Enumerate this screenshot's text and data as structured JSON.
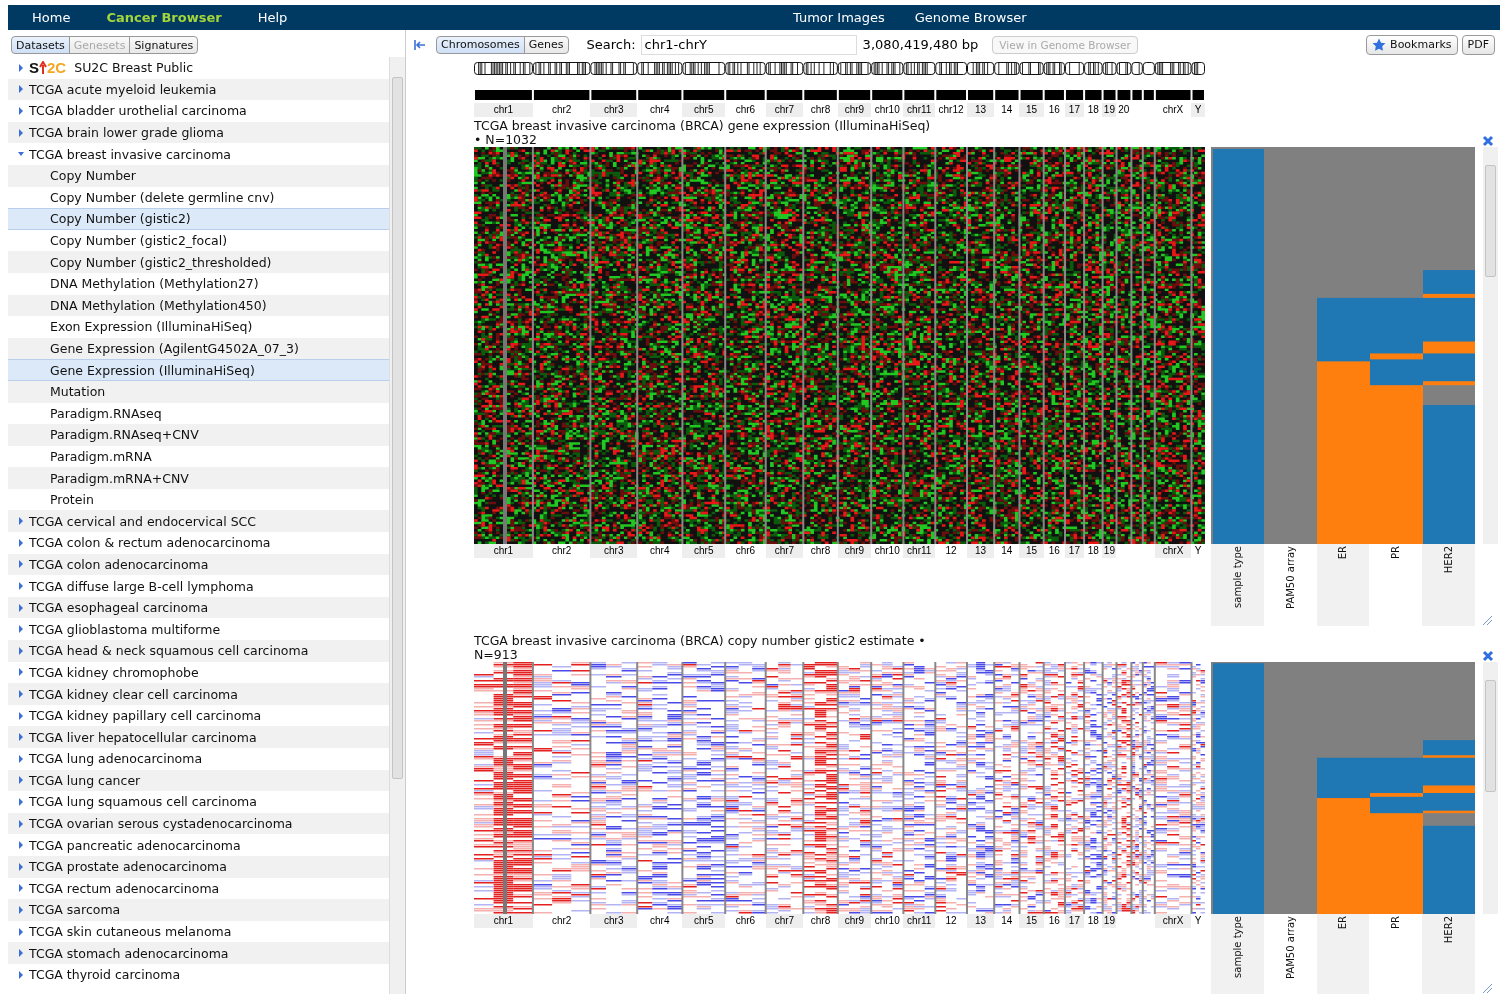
{
  "nav": {
    "left": [
      {
        "label": "Home",
        "selected": false
      },
      {
        "label": "Cancer Browser",
        "selected": true
      },
      {
        "label": "Help",
        "selected": false
      }
    ],
    "right": [
      {
        "label": "Tumor Images"
      },
      {
        "label": "Genome Browser"
      }
    ]
  },
  "sidebar": {
    "tabs": [
      {
        "label": "Datasets",
        "selected": true,
        "disabled": false
      },
      {
        "label": "Genesets",
        "selected": false,
        "disabled": true
      },
      {
        "label": "Signatures",
        "selected": false,
        "disabled": false
      }
    ],
    "items": [
      {
        "logo": [
          "S",
          "2C"
        ],
        "label": "SU2C Breast Public",
        "expanded": false
      },
      {
        "label": "TCGA acute myeloid leukemia",
        "expanded": false
      },
      {
        "label": "TCGA bladder urothelial carcinoma",
        "expanded": false
      },
      {
        "label": "TCGA brain lower grade glioma",
        "expanded": false
      },
      {
        "label": "TCGA breast invasive carcinoma",
        "expanded": true,
        "children": [
          {
            "label": "Copy Number",
            "selected": false
          },
          {
            "label": "Copy Number (delete germline cnv)",
            "selected": false
          },
          {
            "label": "Copy Number (gistic2)",
            "selected": true
          },
          {
            "label": "Copy Number (gistic2_focal)",
            "selected": false
          },
          {
            "label": "Copy Number (gistic2_thresholded)",
            "selected": false
          },
          {
            "label": "DNA Methylation (Methylation27)",
            "selected": false
          },
          {
            "label": "DNA Methylation (Methylation450)",
            "selected": false
          },
          {
            "label": "Exon Expression (IlluminaHiSeq)",
            "selected": false
          },
          {
            "label": "Gene Expression (AgilentG4502A_07_3)",
            "selected": false
          },
          {
            "label": "Gene Expression (IlluminaHiSeq)",
            "selected": true
          },
          {
            "label": "Mutation",
            "selected": false
          },
          {
            "label": "Paradigm.RNAseq",
            "selected": false
          },
          {
            "label": "Paradigm.RNAseq+CNV",
            "selected": false
          },
          {
            "label": "Paradigm.mRNA",
            "selected": false
          },
          {
            "label": "Paradigm.mRNA+CNV",
            "selected": false
          },
          {
            "label": "Protein",
            "selected": false
          }
        ]
      },
      {
        "label": "TCGA cervical and endocervical SCC",
        "expanded": false
      },
      {
        "label": "TCGA colon & rectum adenocarcinoma",
        "expanded": false
      },
      {
        "label": "TCGA colon adenocarcinoma",
        "expanded": false
      },
      {
        "label": "TCGA diffuse large B-cell lymphoma",
        "expanded": false
      },
      {
        "label": "TCGA esophageal carcinoma",
        "expanded": false
      },
      {
        "label": "TCGA glioblastoma multiforme",
        "expanded": false
      },
      {
        "label": "TCGA head & neck squamous cell carcinoma",
        "expanded": false
      },
      {
        "label": "TCGA kidney chromophobe",
        "expanded": false
      },
      {
        "label": "TCGA kidney clear cell carcinoma",
        "expanded": false
      },
      {
        "label": "TCGA kidney papillary cell carcinoma",
        "expanded": false
      },
      {
        "label": "TCGA liver hepatocellular carcinoma",
        "expanded": false
      },
      {
        "label": "TCGA lung adenocarcinoma",
        "expanded": false
      },
      {
        "label": "TCGA lung cancer",
        "expanded": false
      },
      {
        "label": "TCGA lung squamous cell carcinoma",
        "expanded": false
      },
      {
        "label": "TCGA ovarian serous cystadenocarcinoma",
        "expanded": false
      },
      {
        "label": "TCGA pancreatic adenocarcinoma",
        "expanded": false
      },
      {
        "label": "TCGA prostate adenocarcinoma",
        "expanded": false
      },
      {
        "label": "TCGA rectum adenocarcinoma",
        "expanded": false
      },
      {
        "label": "TCGA sarcoma",
        "expanded": false
      },
      {
        "label": "TCGA skin cutaneous melanoma",
        "expanded": false
      },
      {
        "label": "TCGA stomach adenocarcinoma",
        "expanded": false
      },
      {
        "label": "TCGA thyroid carcinoma",
        "expanded": false
      }
    ]
  },
  "toolbar": {
    "view_tabs": [
      {
        "label": "Chromosomes",
        "selected": true
      },
      {
        "label": "Genes",
        "selected": false
      }
    ],
    "search_label": "Search:",
    "search_value": "chr1-chrY",
    "length": "3,080,419,480 bp",
    "genome_button": {
      "label": "View in Genome Browser",
      "disabled": true
    },
    "bookmarks": "Bookmarks",
    "pdf": "PDF"
  },
  "overview_chromosomes": [
    {
      "kind": "label",
      "label": "chr1"
    },
    {
      "kind": "label",
      "label": "chr2"
    },
    {
      "kind": "label",
      "label": "chr3"
    },
    {
      "kind": "label",
      "label": "chr4"
    },
    {
      "kind": "label",
      "label": "chr5"
    },
    {
      "kind": "label",
      "label": "chr6"
    },
    {
      "kind": "label",
      "label": "chr7"
    },
    {
      "kind": "label",
      "label": "chr8"
    },
    {
      "kind": "label",
      "label": "chr9"
    },
    {
      "kind": "label",
      "label": "chr10"
    },
    {
      "kind": "label",
      "label": "chr11"
    },
    {
      "kind": "label",
      "label": "chr12"
    },
    {
      "kind": "label",
      "label": "13"
    },
    {
      "kind": "label",
      "label": "14"
    },
    {
      "kind": "label",
      "label": "15"
    },
    {
      "kind": "label",
      "label": "16"
    },
    {
      "kind": "label",
      "label": "17"
    },
    {
      "kind": "label",
      "label": "18"
    },
    {
      "kind": "label",
      "label": "19"
    },
    {
      "kind": "label",
      "label": "20"
    },
    {
      "kind": "blank"
    },
    {
      "kind": "label",
      "label": "chrX"
    },
    {
      "kind": "label",
      "label": "Y"
    }
  ],
  "panels": [
    {
      "kind": "expression",
      "title": "TCGA breast invasive carcinoma (BRCA) gene expression (IlluminaHiSeq)",
      "count": "• N=1032",
      "chromosomes": [
        {
          "kind": "label",
          "label": "chr1"
        },
        {
          "kind": "label",
          "label": "chr2"
        },
        {
          "kind": "label",
          "label": "chr3"
        },
        {
          "kind": "label",
          "label": "chr4"
        },
        {
          "kind": "label",
          "label": "chr5"
        },
        {
          "kind": "label",
          "label": "chr6"
        },
        {
          "kind": "label",
          "label": "chr7"
        },
        {
          "kind": "label",
          "label": "chr8"
        },
        {
          "kind": "label",
          "label": "chr9"
        },
        {
          "kind": "label",
          "label": "chr10"
        },
        {
          "kind": "label",
          "label": "chr11"
        },
        {
          "kind": "label",
          "label": "12"
        },
        {
          "kind": "label",
          "label": "13"
        },
        {
          "kind": "label",
          "label": "14"
        },
        {
          "kind": "label",
          "label": "15"
        },
        {
          "kind": "label",
          "label": "16"
        },
        {
          "kind": "label",
          "label": "17"
        },
        {
          "kind": "label",
          "label": "18"
        },
        {
          "kind": "label",
          "label": "19"
        },
        {
          "kind": "blank"
        },
        {
          "kind": "label",
          "label": "chrX"
        },
        {
          "kind": "label",
          "label": "Y"
        }
      ],
      "phenotypes": [
        {
          "label": "sample type"
        },
        {
          "label": "PAM50 array"
        },
        {
          "label": "ER"
        },
        {
          "label": "PR"
        },
        {
          "label": "HER2"
        }
      ]
    },
    {
      "kind": "copy_number",
      "title": "TCGA breast invasive carcinoma (BRCA) copy number gistic2 estimate •",
      "count": "N=913",
      "chromosomes": [
        {
          "kind": "label",
          "label": "chr1"
        },
        {
          "kind": "label",
          "label": "chr2"
        },
        {
          "kind": "label",
          "label": "chr3"
        },
        {
          "kind": "label",
          "label": "chr4"
        },
        {
          "kind": "label",
          "label": "chr5"
        },
        {
          "kind": "label",
          "label": "chr6"
        },
        {
          "kind": "label",
          "label": "chr7"
        },
        {
          "kind": "label",
          "label": "chr8"
        },
        {
          "kind": "label",
          "label": "chr9"
        },
        {
          "kind": "label",
          "label": "chr10"
        },
        {
          "kind": "label",
          "label": "chr11"
        },
        {
          "kind": "label",
          "label": "12"
        },
        {
          "kind": "label",
          "label": "13"
        },
        {
          "kind": "label",
          "label": "14"
        },
        {
          "kind": "label",
          "label": "15"
        },
        {
          "kind": "label",
          "label": "16"
        },
        {
          "kind": "label",
          "label": "17"
        },
        {
          "kind": "label",
          "label": "18"
        },
        {
          "kind": "label",
          "label": "19"
        },
        {
          "kind": "blank"
        },
        {
          "kind": "label",
          "label": "chrX"
        },
        {
          "kind": "label",
          "label": "Y"
        }
      ],
      "phenotypes": [
        {
          "label": "sample type"
        },
        {
          "label": "PAM50 array"
        },
        {
          "label": "ER"
        },
        {
          "label": "PR"
        },
        {
          "label": "HER2"
        }
      ]
    }
  ]
}
